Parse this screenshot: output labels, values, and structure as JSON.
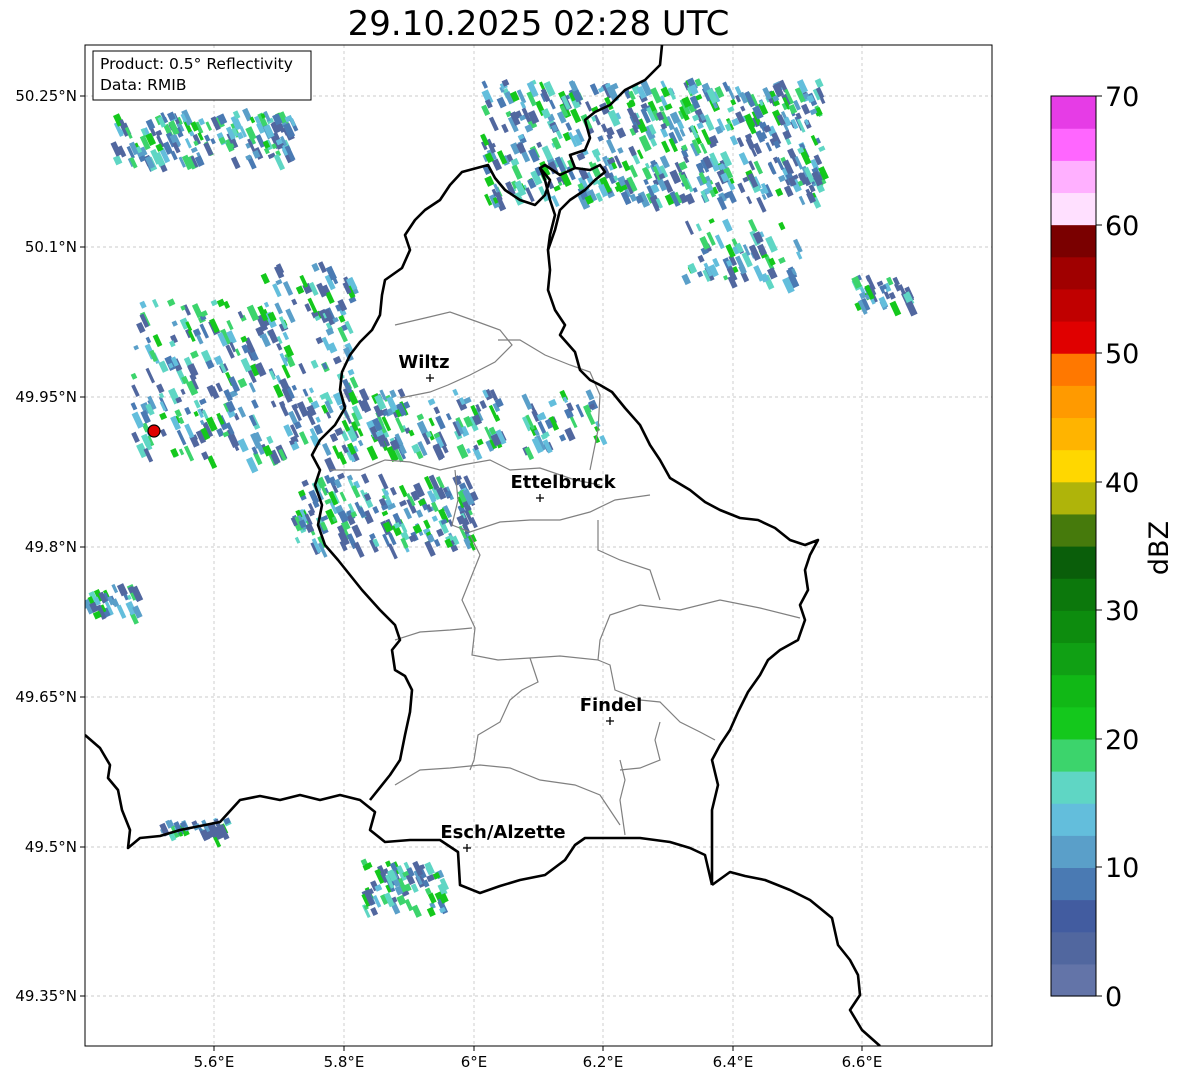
{
  "title": "29.10.2025 02:28 UTC",
  "info": {
    "product": "Product: 0.5° Reflectivity",
    "data": "Data: RMIB"
  },
  "lat_ticks": [
    "50.25°N",
    "50.1°N",
    "49.95°N",
    "49.8°N",
    "49.65°N",
    "49.5°N",
    "49.35°N"
  ],
  "lon_ticks": [
    "5.6°E",
    "5.8°E",
    "6°E",
    "6.2°E",
    "6.4°E",
    "6.6°E"
  ],
  "colorbar": {
    "label": "dBZ",
    "ticks": [
      "0",
      "10",
      "20",
      "30",
      "40",
      "50",
      "60",
      "70"
    ],
    "colors": [
      "#6374a8",
      "#51679f",
      "#425ca0",
      "#4a7ab3",
      "#5a9fc9",
      "#63bedc",
      "#5fd6c4",
      "#3cd46c",
      "#14c81c",
      "#11b816",
      "#10a014",
      "#0d8c0e",
      "#0c780c",
      "#0a5e0a",
      "#467a0c",
      "#afb40a",
      "#ffd700",
      "#ffb400",
      "#ff9a00",
      "#ff7800",
      "#e00000",
      "#c00000",
      "#a00000",
      "#7a0000",
      "#ffe0ff",
      "#ffb0ff",
      "#ff66ff",
      "#e63ce6"
    ]
  },
  "cities": [
    {
      "name": "Wiltz"
    },
    {
      "name": "Ettelbruck"
    },
    {
      "name": "Findel"
    },
    {
      "name": "Esch/Alzette"
    }
  ]
}
